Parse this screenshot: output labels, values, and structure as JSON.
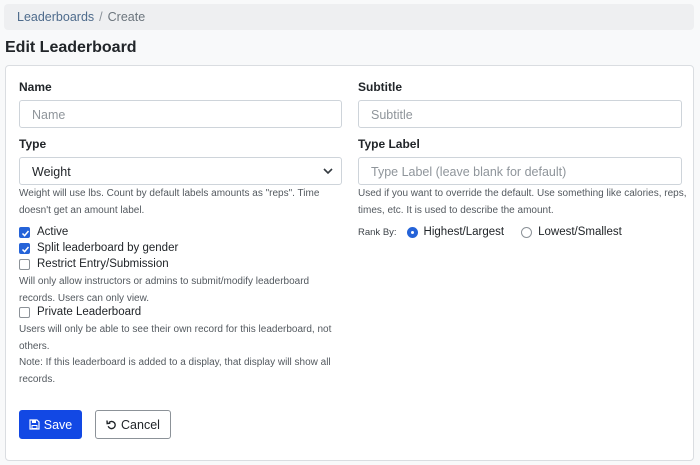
{
  "breadcrumb": {
    "parent": "Leaderboards",
    "separator": "/",
    "current": "Create"
  },
  "page": {
    "title": "Edit Leaderboard"
  },
  "form": {
    "name": {
      "label": "Name",
      "placeholder": "Name",
      "value": ""
    },
    "subtitle": {
      "label": "Subtitle",
      "placeholder": "Subtitle",
      "value": ""
    },
    "type": {
      "label": "Type",
      "selected": "Weight",
      "help": "Weight will use lbs. Count by default labels amounts as \"reps\". Time doesn't get an amount label."
    },
    "type_label": {
      "label": "Type Label",
      "placeholder": "Type Label (leave blank for default)",
      "help": "Used if you want to override the default. Use something like calories, reps, times, etc. It is used to describe the amount."
    },
    "checkboxes": [
      {
        "label": "Active",
        "checked": true
      },
      {
        "label": "Split leaderboard by gender",
        "checked": true
      },
      {
        "label": "Restrict Entry/Submission",
        "checked": false,
        "help": "Will only allow instructors or admins to submit/modify leaderboard records. Users can only view."
      },
      {
        "label": "Private Leaderboard",
        "checked": false,
        "help": "Users will only be able to see their own record for this leaderboard, not others.",
        "note": "Note: If this leaderboard is added to a display, that display will show all records."
      }
    ],
    "rank_by": {
      "label": "Rank By:",
      "options": [
        "Highest/Largest",
        "Lowest/Smallest"
      ],
      "selected": "Highest/Largest"
    }
  },
  "actions": {
    "save_label": "Save",
    "cancel_label": "Cancel"
  },
  "colors": {
    "primary": "#1248e4",
    "checkbox": "#2563d8",
    "link": "#4e6b8c"
  }
}
